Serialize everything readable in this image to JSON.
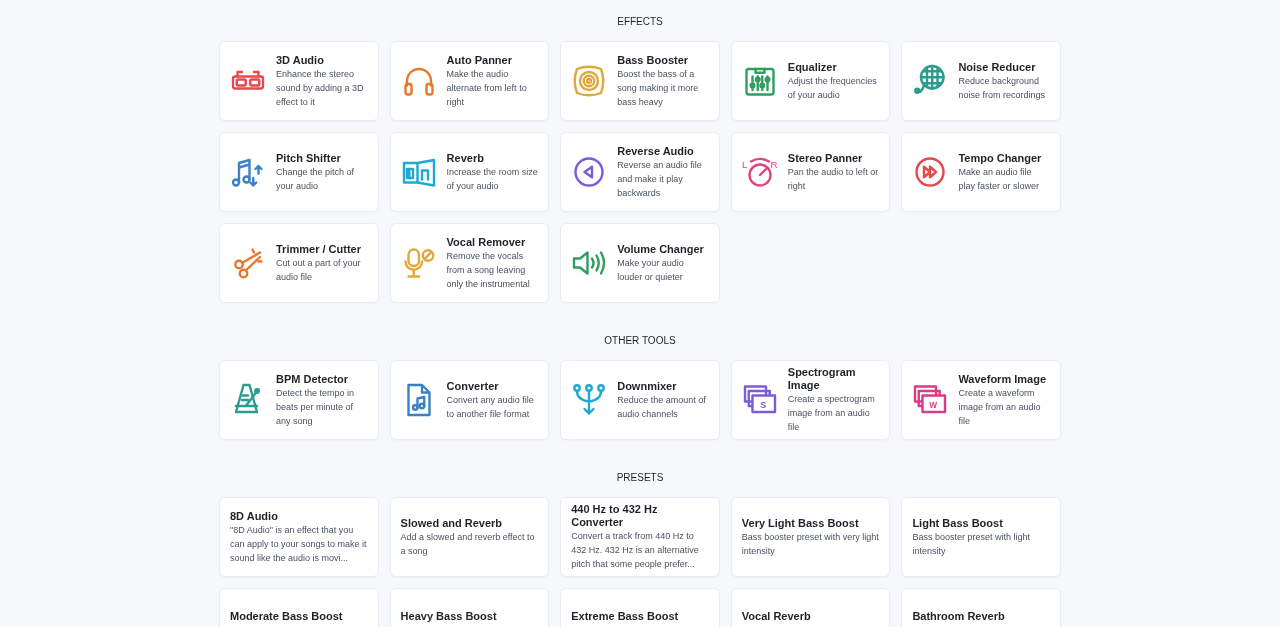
{
  "sections": [
    {
      "heading": "EFFECTS",
      "kind": "tools",
      "items": [
        {
          "title": "3D Audio",
          "description": "Enhance the stereo sound by adding a 3D effect to it"
        },
        {
          "title": "Auto Panner",
          "description": "Make the audio alternate from left to right"
        },
        {
          "title": "Bass Booster",
          "description": "Boost the bass of a song making it more bass heavy"
        },
        {
          "title": "Equalizer",
          "description": "Adjust the frequencies of your audio"
        },
        {
          "title": "Noise Reducer",
          "description": "Reduce background noise from recordings"
        },
        {
          "title": "Pitch Shifter",
          "description": "Change the pitch of your audio"
        },
        {
          "title": "Reverb",
          "description": "Increase the room size of your audio"
        },
        {
          "title": "Reverse Audio",
          "description": "Reverse an audio file and make it play backwards"
        },
        {
          "title": "Stereo Panner",
          "description": "Pan the audio to left or right",
          "icon_labels": [
            "L",
            "R"
          ]
        },
        {
          "title": "Tempo Changer",
          "description": "Make an audio file play faster or slower"
        },
        {
          "title": "Trimmer / Cutter",
          "description": "Cut out a part of your audio file"
        },
        {
          "title": "Vocal Remover",
          "description": "Remove the vocals from a song leaving only the instrumental"
        },
        {
          "title": "Volume Changer",
          "description": "Make your audio louder or quieter"
        }
      ]
    },
    {
      "heading": "OTHER TOOLS",
      "kind": "tools",
      "items": [
        {
          "title": "BPM Detector",
          "description": "Detect the tempo in beats per minute of any song"
        },
        {
          "title": "Converter",
          "description": "Convert any audio file to another file format"
        },
        {
          "title": "Downmixer",
          "description": "Reduce the amount of audio channels"
        },
        {
          "title": "Spectrogram Image",
          "description": "Create a spectrogram image from an audio file",
          "icon_labels": [
            "S"
          ]
        },
        {
          "title": "Waveform Image",
          "description": "Create a waveform image from an audio file",
          "icon_labels": [
            "W"
          ]
        }
      ]
    },
    {
      "heading": "PRESETS",
      "kind": "presets",
      "items": [
        {
          "title": "8D Audio",
          "description": "\"8D Audio\" is an effect that you can apply to your songs to make it sound like the audio is movi..."
        },
        {
          "title": "Slowed and Reverb",
          "description": "Add a slowed and reverb effect to a song"
        },
        {
          "title": "440 Hz to 432 Hz Converter",
          "description": "Convert a track from 440 Hz to 432 Hz. 432 Hz is an alternative pitch that some people prefer..."
        },
        {
          "title": "Very Light Bass Boost",
          "description": "Bass booster preset with very light intensity"
        },
        {
          "title": "Light Bass Boost",
          "description": "Bass booster preset with light intensity"
        },
        {
          "title": "Moderate Bass Boost"
        },
        {
          "title": "Heavy Bass Boost"
        },
        {
          "title": "Extreme Bass Boost"
        },
        {
          "title": "Vocal Reverb"
        },
        {
          "title": "Bathroom Reverb"
        }
      ]
    }
  ]
}
